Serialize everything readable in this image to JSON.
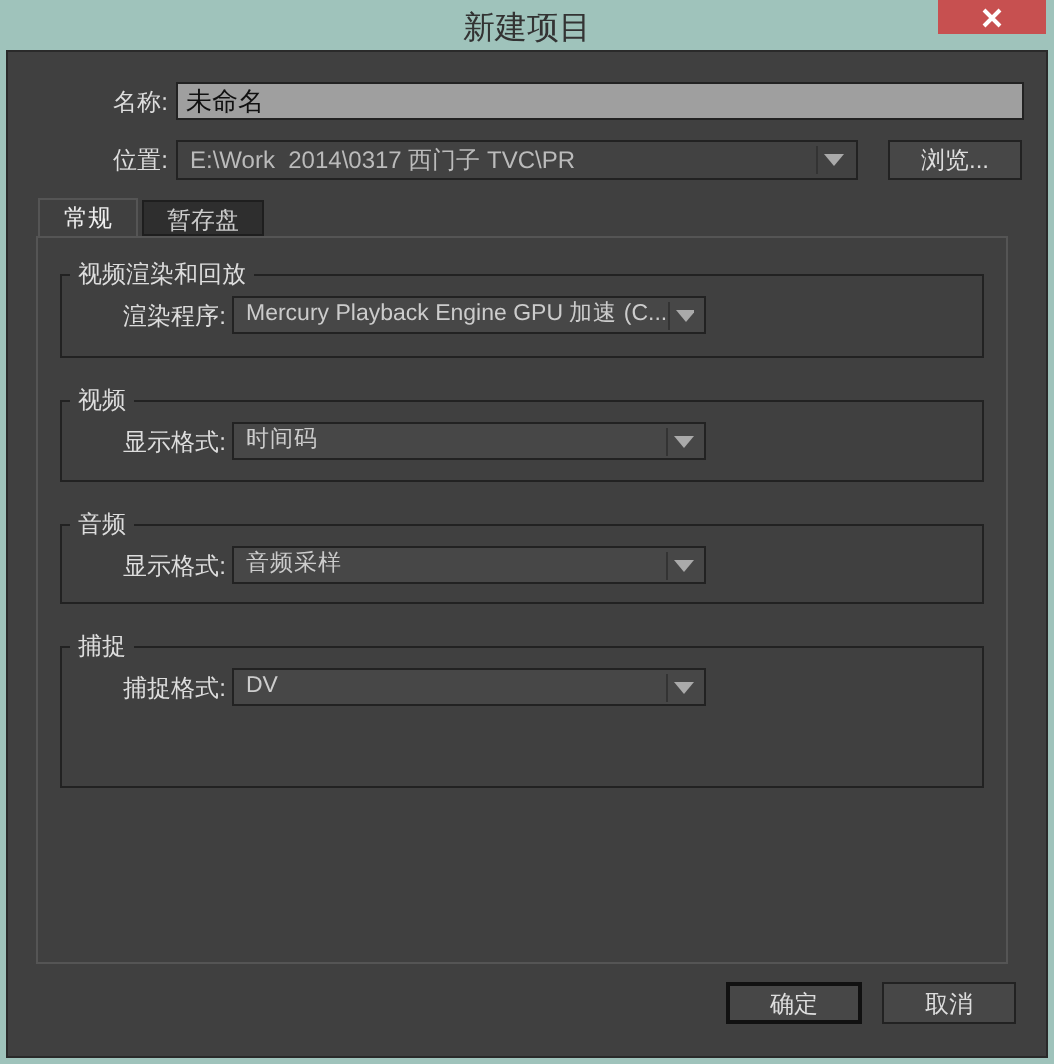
{
  "window": {
    "title": "新建项目"
  },
  "name_field": {
    "label": "名称:",
    "value": "未命名"
  },
  "location": {
    "label": "位置:",
    "value": "E:\\Work  2014\\0317 西门子 TVC\\PR",
    "browse_button": "浏览..."
  },
  "tabs": [
    {
      "label": "常规",
      "selected": true
    },
    {
      "label": "暂存盘",
      "selected": false
    }
  ],
  "groups": [
    {
      "title": "视频渲染和回放",
      "label": "渲染程序:",
      "value": "Mercury Playback Engine GPU 加速 (C..."
    },
    {
      "title": "视频",
      "label": "显示格式:",
      "value": "时间码"
    },
    {
      "title": "音频",
      "label": "显示格式:",
      "value": "音频采样"
    },
    {
      "title": "捕捉",
      "label": "捕捉格式:",
      "value": "DV"
    }
  ],
  "buttons": [
    {
      "label": "确定",
      "kind": "default"
    },
    {
      "label": "取消",
      "kind": "normal"
    }
  ]
}
